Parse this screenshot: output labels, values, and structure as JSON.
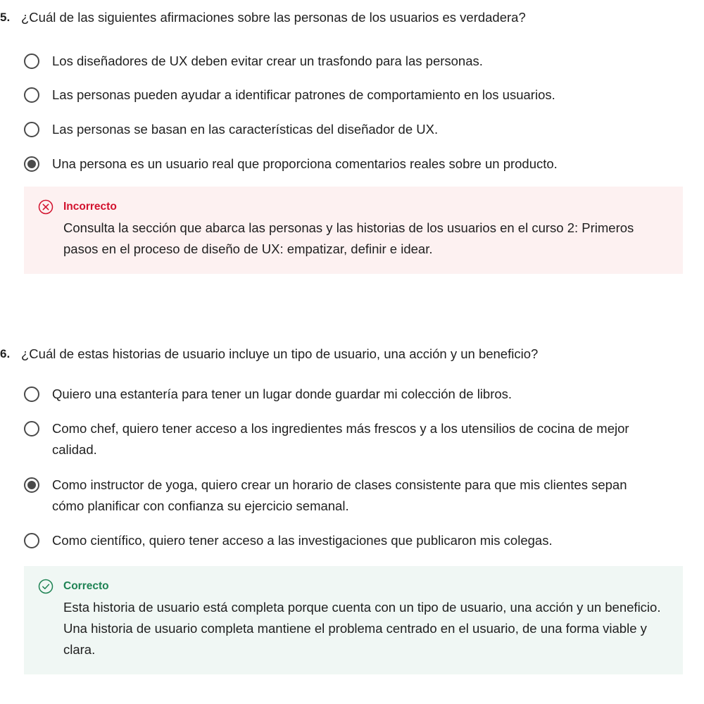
{
  "questions": [
    {
      "number": "5.",
      "text": "¿Cuál de las siguientes afirmaciones sobre las personas de los usuarios es verdadera?",
      "options": [
        {
          "label": "Los diseñadores de UX deben evitar crear un trasfondo para las personas.",
          "selected": false
        },
        {
          "label": "Las personas pueden ayudar a identificar patrones de comportamiento en los usuarios.",
          "selected": false
        },
        {
          "label": "Las personas se basan en las características del diseñador de UX.",
          "selected": false
        },
        {
          "label": "Una persona es un usuario real que proporciona comentarios reales sobre un producto.",
          "selected": true
        }
      ],
      "feedback": {
        "status": "incorrect",
        "title": "Incorrecto",
        "icon": "x-circle-icon",
        "color": "#d2122e",
        "background": "#fdf1f1",
        "body": "Consulta la sección que abarca las personas y las historias de los usuarios en el curso 2: Primeros pasos en el proceso de diseño de UX: empatizar, definir e idear."
      }
    },
    {
      "number": "6.",
      "text": "¿Cuál de estas historias de usuario incluye un tipo de usuario, una acción y un beneficio?",
      "options": [
        {
          "label": "Quiero una estantería para tener un lugar donde guardar mi colección de libros.",
          "selected": false
        },
        {
          "label": "Como chef, quiero tener acceso a los ingredientes más frescos y a los utensilios de cocina de mejor calidad.",
          "selected": false
        },
        {
          "label": "Como instructor de yoga, quiero crear un horario de clases consistente para que mis clientes sepan cómo planificar con confianza su ejercicio semanal.",
          "selected": true
        },
        {
          "label": "Como científico, quiero tener acceso a las investigaciones que publicaron mis colegas.",
          "selected": false
        }
      ],
      "feedback": {
        "status": "correct",
        "title": "Correcto",
        "icon": "check-circle-icon",
        "color": "#1f8354",
        "background": "#f0f7f4",
        "body": "Esta historia de usuario está completa porque cuenta con un tipo de usuario, una acción y un beneficio. Una historia de usuario completa mantiene el problema centrado en el usuario, de una forma viable y clara."
      }
    }
  ]
}
